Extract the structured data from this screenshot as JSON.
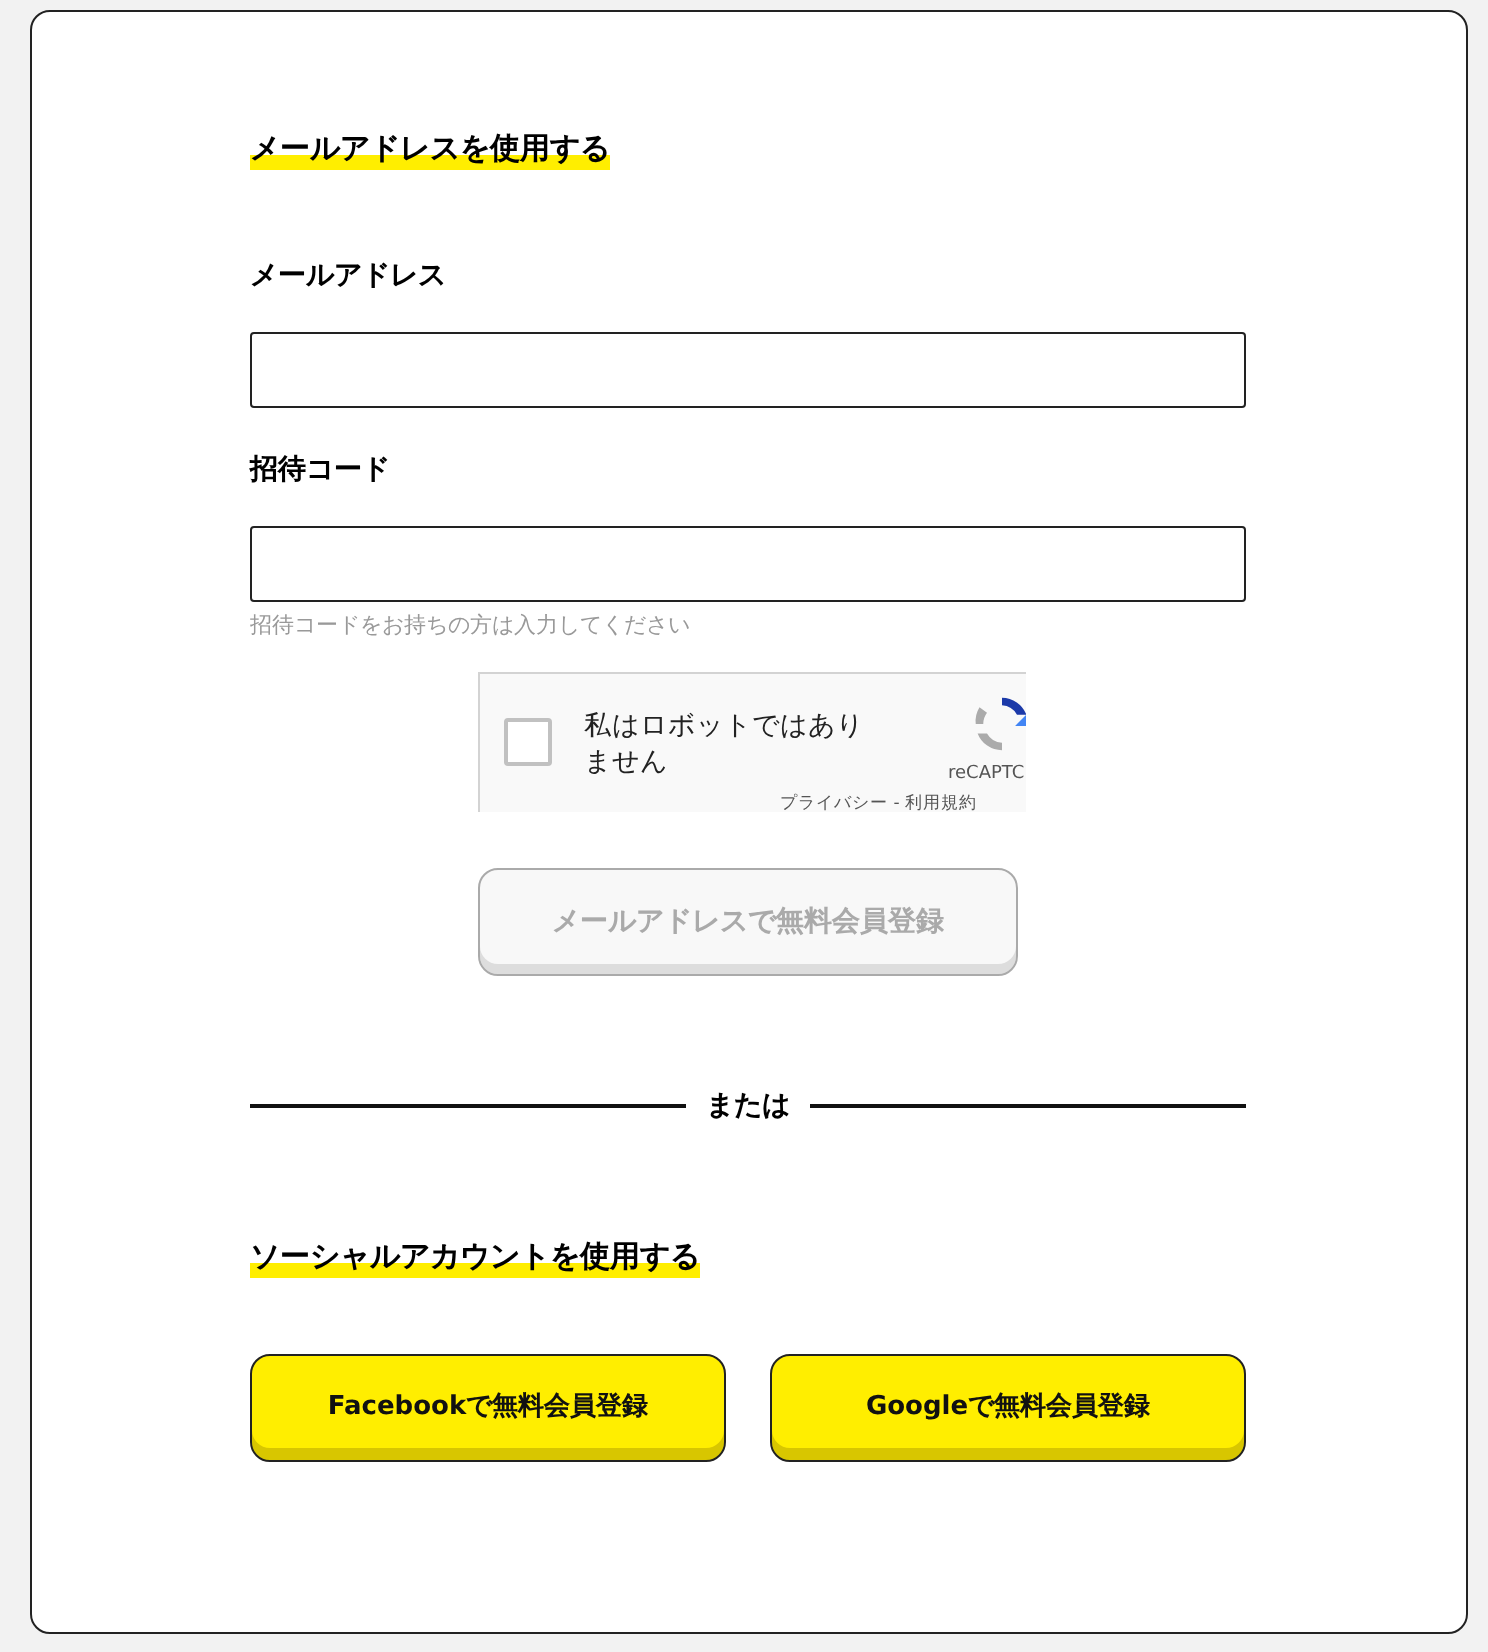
{
  "email_section": {
    "heading": "メールアドレスを使用する",
    "fields": [
      {
        "label": "メールアドレス"
      },
      {
        "label": "招待コード",
        "hint": "招待コードをお持ちの方は入力してください"
      }
    ],
    "captcha": {
      "label": "私はロボットではありません",
      "checked": false,
      "brand": "reCAPTC",
      "links": "プライバシー - 利用規約"
    },
    "submit": {
      "label": "メールアドレスで無料会員登録",
      "disabled": true
    }
  },
  "divider": "または",
  "social_section": {
    "heading": "ソーシャルアカウントを使用する",
    "buttons": [
      {
        "label": "Facebookで無料会員登録"
      },
      {
        "label": "Googleで無料会員登録"
      }
    ]
  }
}
